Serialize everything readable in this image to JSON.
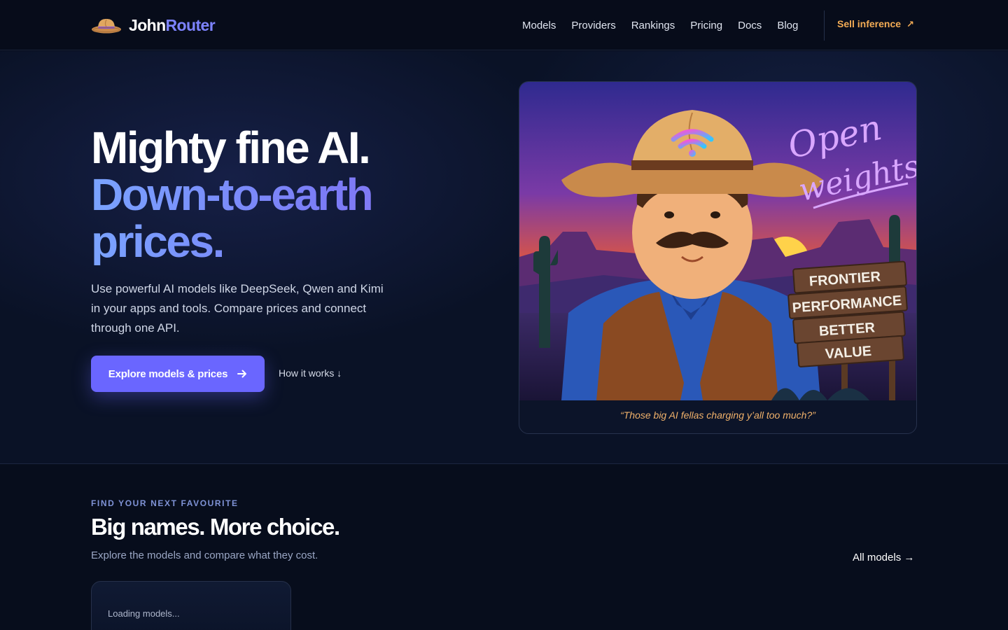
{
  "brand": {
    "name_part1": "John",
    "name_part2": "Router",
    "logo_icon": "cowboy-hat-icon"
  },
  "nav": {
    "links": [
      "Models",
      "Providers",
      "Rankings",
      "Pricing",
      "Docs",
      "Blog"
    ],
    "sell_label": "Sell inference",
    "sell_icon": "arrow-up-right-icon"
  },
  "hero": {
    "headline_line1": "Mighty fine AI.",
    "headline_line2": "Down-to-earth prices.",
    "subtitle": "Use powerful AI models like DeepSeek, Qwen and Kimi in your apps and tools. Compare prices and connect through one API.",
    "cta_label": "Explore models & prices",
    "cta_icon": "arrow-right-icon",
    "secondary_label": "How it works ↓",
    "illustration": {
      "script_text_line1": "Open",
      "script_text_line2": "weights.",
      "sign_lines": [
        "FRONTIER",
        "PERFORMANCE",
        "BETTER",
        "VALUE"
      ],
      "caption": "“Those big AI fellas charging y’all too much?”"
    }
  },
  "models_section": {
    "eyebrow": "FIND YOUR NEXT FAVOURITE",
    "title": "Big names. More choice.",
    "subtitle": "Explore the models and compare what they cost.",
    "all_models_label": "All models →",
    "loading_text": "Loading models..."
  },
  "colors": {
    "background": "#070d1c",
    "accent": "#6a66ff",
    "brand_purple": "#7d83ff",
    "sell_orange": "#f3ac55",
    "caption_orange": "#f0b16a",
    "eyebrow": "#7f93d6"
  }
}
